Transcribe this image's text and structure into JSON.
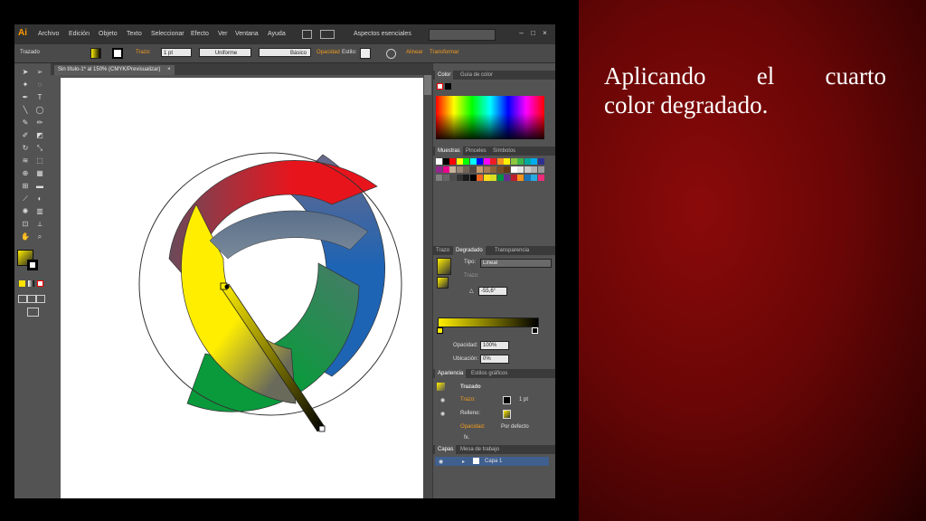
{
  "slide": {
    "caption_line1": [
      "Aplicando",
      "el",
      "cuarto"
    ],
    "caption_line2": "color degradado."
  },
  "app": {
    "logo": "Ai",
    "menu": [
      "Archivo",
      "Edición",
      "Objeto",
      "Texto",
      "Seleccionar",
      "Efecto",
      "Ver",
      "Ventana",
      "Ayuda"
    ],
    "workspace": "Aspectos esenciales",
    "window_controls": [
      "–",
      "□",
      "×"
    ]
  },
  "control_bar": {
    "object_label": "Trazado",
    "stroke_label": "Trazo:",
    "stroke_weight": "1 pt",
    "profile": "Uniforme",
    "brush": "Básico",
    "opacity_label": "Opacidad",
    "style_label": "Estilo:",
    "align_label": "Alinear",
    "transform_label": "Transformar"
  },
  "document": {
    "tab_title": "Sin título-1* al 150% (CMYK/Previsualizar)",
    "close": "×"
  },
  "color_panel": {
    "tabs": [
      "Color",
      "Guía de color"
    ]
  },
  "swatches_panel": {
    "tabs": [
      "Muestras",
      "Pinceles",
      "Símbolos"
    ],
    "colors": [
      "#ffffff",
      "#000000",
      "#ff0000",
      "#ffff00",
      "#00ff00",
      "#00ffff",
      "#0000ff",
      "#ff00ff",
      "#ed1c24",
      "#f7941d",
      "#fff200",
      "#8dc63f",
      "#39b54a",
      "#00a99d",
      "#00aeef",
      "#2e3192",
      "#92278f",
      "#ec008c",
      "#c7b299",
      "#998675",
      "#736357",
      "#534741",
      "#c69c6d",
      "#a67c52",
      "#8c6239",
      "#754c24",
      "#603913",
      "#ffffff",
      "#e6e6e6",
      "#cccccc",
      "#b3b3b3",
      "#999999",
      "#808080",
      "#666666",
      "#4d4d4d",
      "#333333",
      "#1a1a1a",
      "#000000",
      "#f26522",
      "#ffde17",
      "#d7df23",
      "#009444",
      "#662d91",
      "#be1e2d",
      "#f7941d",
      "#1b75bc",
      "#27aae1",
      "#ee2a7b"
    ]
  },
  "gradient_panel": {
    "tabs": [
      "Trazo",
      "Degradado",
      "Transparencia"
    ],
    "type_label": "Tipo:",
    "type_value": "Lineal",
    "stroke_label": "Trazo:",
    "angle_value": "-55,6°",
    "opacity_label": "Opacidad:",
    "opacity_value": "100%",
    "location_label": "Ubicación:",
    "location_value": "0%",
    "gradient_start": "#ffee00",
    "gradient_end": "#000000"
  },
  "appearance_panel": {
    "tabs": [
      "Apariencia",
      "Estilos gráficos"
    ],
    "title": "Trazado",
    "rows": [
      {
        "label": "Trazo:",
        "value": "1 pt"
      },
      {
        "label": "Relleno:",
        "value": ""
      },
      {
        "label": "Opacidad:",
        "value": "Por defecto"
      }
    ],
    "fx": "fx."
  },
  "layers_panel": {
    "tabs": [
      "Capas",
      "Mesa de trabajo"
    ],
    "layer_name": "Capa 1"
  },
  "artwork": {
    "ring_colors": [
      "#e8141c",
      "#1e64b4",
      "#0a9a3c",
      "#ffee00"
    ],
    "inner_color": "#5a6f8a"
  }
}
